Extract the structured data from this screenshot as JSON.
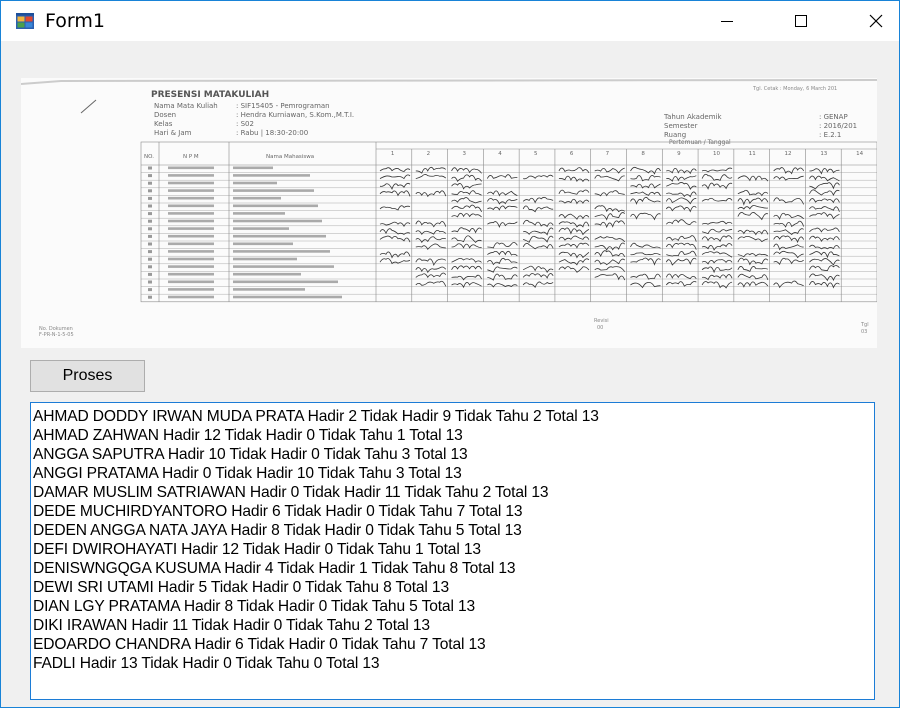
{
  "window": {
    "title": "Form1",
    "controls": {
      "minimize": "minimize-icon",
      "maximize": "maximize-icon",
      "close": "close-icon"
    }
  },
  "scan": {
    "heading": "PRESENSI MATAKULIAH",
    "info_labels": [
      "Nama Mata Kuliah",
      "Dosen",
      "Kelas",
      "Hari & Jam"
    ],
    "info_values": [
      ": SIF15405 - Pemrograman",
      ": Hendra Kurniawan, S.Kom.,M.T.I.",
      ": S02",
      ": Rabu | 18:30-20:00"
    ],
    "right_labels": [
      "Tahun Akademik",
      "Semester",
      "Ruang"
    ],
    "right_values": [
      ": GENAP",
      ": 2016/201",
      ": E.2.1"
    ],
    "printed": "Tgl. Cetak : Monday, 6 March 201",
    "meeting_header": "Pertemuan / Tanggal",
    "col_no": "NO.",
    "col_npm": "N P M",
    "col_name": "Nama Mahasiswa",
    "meeting_numbers": [
      "1",
      "2",
      "3",
      "4",
      "5",
      "6",
      "7",
      "8",
      "9",
      "10",
      "11",
      "12",
      "13",
      "14"
    ],
    "footer_left": "No. Dokumen",
    "footer_left2": "F-PR-N-1-5-05",
    "footer_mid": "Revisi",
    "footer_mid2": "00",
    "footer_right": "Tgl",
    "footer_right2": "03"
  },
  "button": {
    "label": "Proses"
  },
  "results": [
    "AHMAD DODDY IRWAN MUDA PRATA Hadir 2 Tidak Hadir 9 Tidak Tahu 2 Total 13",
    "AHMAD ZAHWAN Hadir 12 Tidak Hadir 0 Tidak Tahu 1 Total 13",
    "ANGGA SAPUTRA Hadir 10 Tidak Hadir 0 Tidak Tahu 3 Total 13",
    "ANGGI PRATAMA Hadir 0 Tidak Hadir 10 Tidak Tahu 3 Total 13",
    "DAMAR MUSLIM SATRIAWAN Hadir 0 Tidak Hadir 11 Tidak Tahu 2 Total 13",
    "DEDE MUCHIRDYANTORO Hadir 6 Tidak Hadir 0 Tidak Tahu 7 Total 13",
    "DEDEN ANGGA NATA JAYA Hadir 8 Tidak Hadir 0 Tidak Tahu 5 Total 13",
    "DEFI DWIROHAYATI Hadir 12 Tidak Hadir 0 Tidak Tahu 1 Total 13",
    "DENISWNGQGA KUSUMA Hadir 4 Tidak Hadir 1 Tidak Tahu 8 Total 13",
    "DEWI SRI UTAMI Hadir 5 Tidak Hadir 0 Tidak Tahu 8 Total 13",
    "DIAN LGY PRATAMA Hadir 8 Tidak Hadir 0 Tidak Tahu 5 Total 13",
    "DIKI IRAWAN Hadir 11 Tidak Hadir 0 Tidak Tahu 2 Total 13",
    "EDOARDO CHANDRA Hadir 6 Tidak Hadir 0 Tidak Tahu 7 Total 13",
    "FADLI Hadir 13 Tidak Hadir 0 Tidak Tahu 0 Total 13"
  ]
}
